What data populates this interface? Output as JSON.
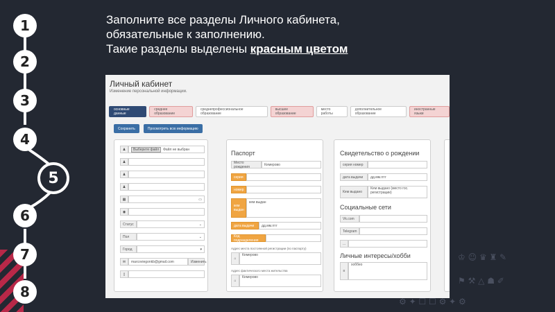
{
  "steps": [
    "1",
    "2",
    "3",
    "4",
    "5",
    "6",
    "7",
    "8"
  ],
  "active_step": "5",
  "heading": {
    "line1": "Заполните все разделы Личного кабинета,",
    "line2": "обязательные к заполнению.",
    "line3_prefix": "Такие разделы выделены ",
    "line3_highlight": "красным цветом"
  },
  "screenshot": {
    "title": "Личный кабинет",
    "subtitle": "Изменение персональной информации.",
    "tabs": [
      {
        "label": "основные данные",
        "state": "active"
      },
      {
        "label": "среднее образование",
        "state": "required"
      },
      {
        "label": "среднепрофессиональное образование",
        "state": "normal"
      },
      {
        "label": "высшее образование",
        "state": "required"
      },
      {
        "label": "место работы",
        "state": "normal"
      },
      {
        "label": "дополнительное образование",
        "state": "normal"
      },
      {
        "label": "иностранные языки",
        "state": "required"
      }
    ],
    "buttons": {
      "save": "Сохранить",
      "view_all": "Просмотреть всю информацию"
    },
    "personal": {
      "file_button": "Выберите файл",
      "file_status": "Файл не выбран",
      "status_label": "Статус",
      "gender_label": "Пол",
      "city_label": "Город",
      "email_value": "marcoviegonkb@gmail.com",
      "change_link": "Изменить"
    },
    "passport": {
      "heading": "Паспорт",
      "issue_place_label": "Место рождения",
      "issue_place_value": "Кемерово",
      "series_label": "серия",
      "number_label": "номер",
      "issued_by_label": "кем выдан",
      "issued_by_value": "кем выдан",
      "issue_date_label": "дата выдачи",
      "date_placeholder": "дд.мм.гггг",
      "division_code_label": "Код подразделения",
      "reg_address_label": "Адрес места постоянной регистрации (по паспорту)",
      "reg_address_value": "Кемерово",
      "actual_address_label": "Адрес фактического места жительства",
      "actual_address_value": "Кемерово"
    },
    "birth_cert": {
      "heading": "Свидетельство о рождении",
      "series_number_label": "серия номер",
      "issue_date_label": "дата выдачи",
      "date_placeholder": "дд.мм.гггг",
      "issued_by_label": "Кем выдано",
      "issued_by_placeholder": "Кем выдано (место гос. регистрации)"
    },
    "social": {
      "heading": "Социальные сети",
      "vk_label": "Vk.com",
      "telegram_label": "Telegram",
      "other_label": "..."
    },
    "hobbies": {
      "heading": "Личные интересы/хобби",
      "value": "хоббео"
    }
  },
  "colors": {
    "background": "#232832",
    "active_tab": "#2f4a74",
    "required_tab": "#f4d3d3",
    "required_field": "#f0a542",
    "button": "#3a6ea5"
  }
}
